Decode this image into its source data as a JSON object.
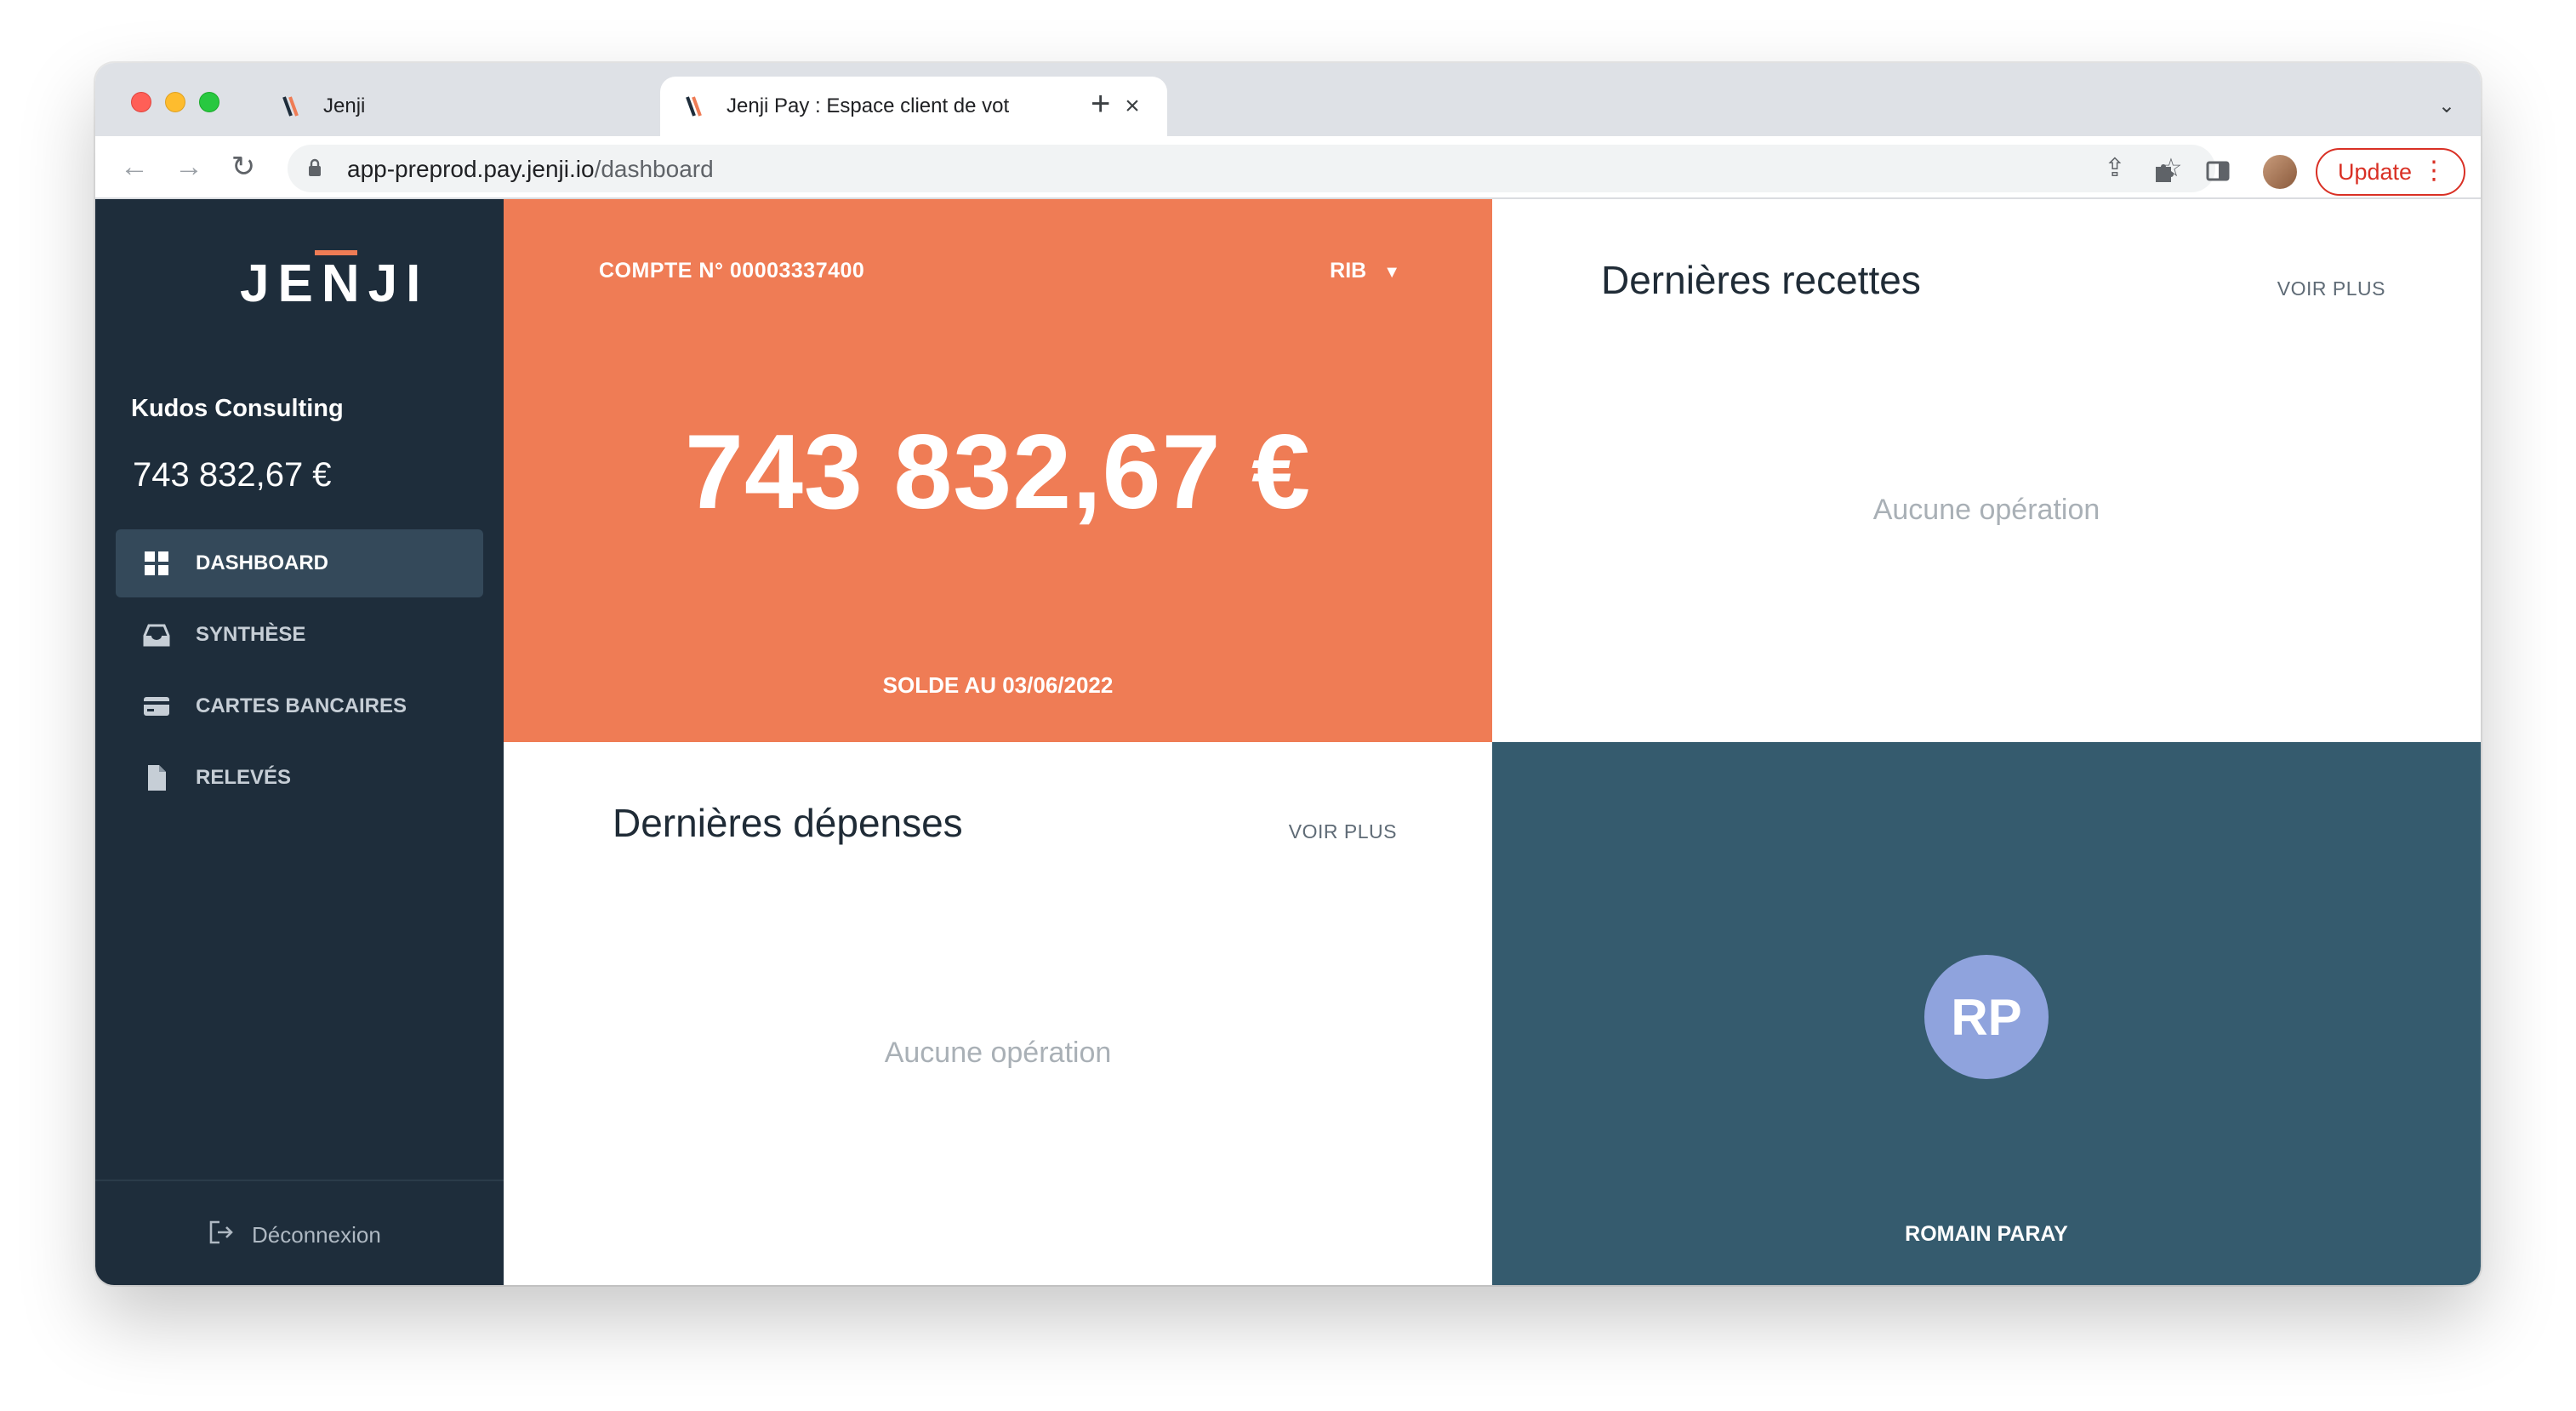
{
  "browser": {
    "tabs": [
      {
        "title": "Jenji",
        "active": false
      },
      {
        "title": "Jenji Pay : Espace client de vot",
        "active": true
      }
    ],
    "new_tab_label": "+",
    "url_host": "app-preprod.pay.jenji.io",
    "url_path": "/dashboard",
    "update_label": "Update"
  },
  "sidebar": {
    "logo_text": "JENJI",
    "company": "Kudos Consulting",
    "balance": "743 832,67 €",
    "nav": [
      {
        "label": "DASHBOARD",
        "icon": "grid-icon",
        "active": true
      },
      {
        "label": "SYNTHÈSE",
        "icon": "inbox-icon",
        "active": false
      },
      {
        "label": "CARTES BANCAIRES",
        "icon": "credit-card-icon",
        "active": false
      },
      {
        "label": "RELEVÉS",
        "icon": "document-icon",
        "active": false
      }
    ],
    "logout_label": "Déconnexion"
  },
  "balance_card": {
    "account": "COMPTE N° 00003337400",
    "rib_label": "RIB",
    "amount": "743 832,67 €",
    "date_label": "SOLDE AU 03/06/2022"
  },
  "recettes": {
    "title": "Dernières recettes",
    "more_label": "VOIR PLUS",
    "empty_label": "Aucune opération"
  },
  "depenses": {
    "title": "Dernières dépenses",
    "more_label": "VOIR PLUS",
    "empty_label": "Aucune opération"
  },
  "user": {
    "initials": "RP",
    "name": "ROMAIN PARAY"
  },
  "colors": {
    "sidebar_bg": "#1e2d3b",
    "accent_orange": "#ef7c55",
    "user_card_bg": "#355b6e",
    "avatar_bg": "#8fa3dd"
  }
}
